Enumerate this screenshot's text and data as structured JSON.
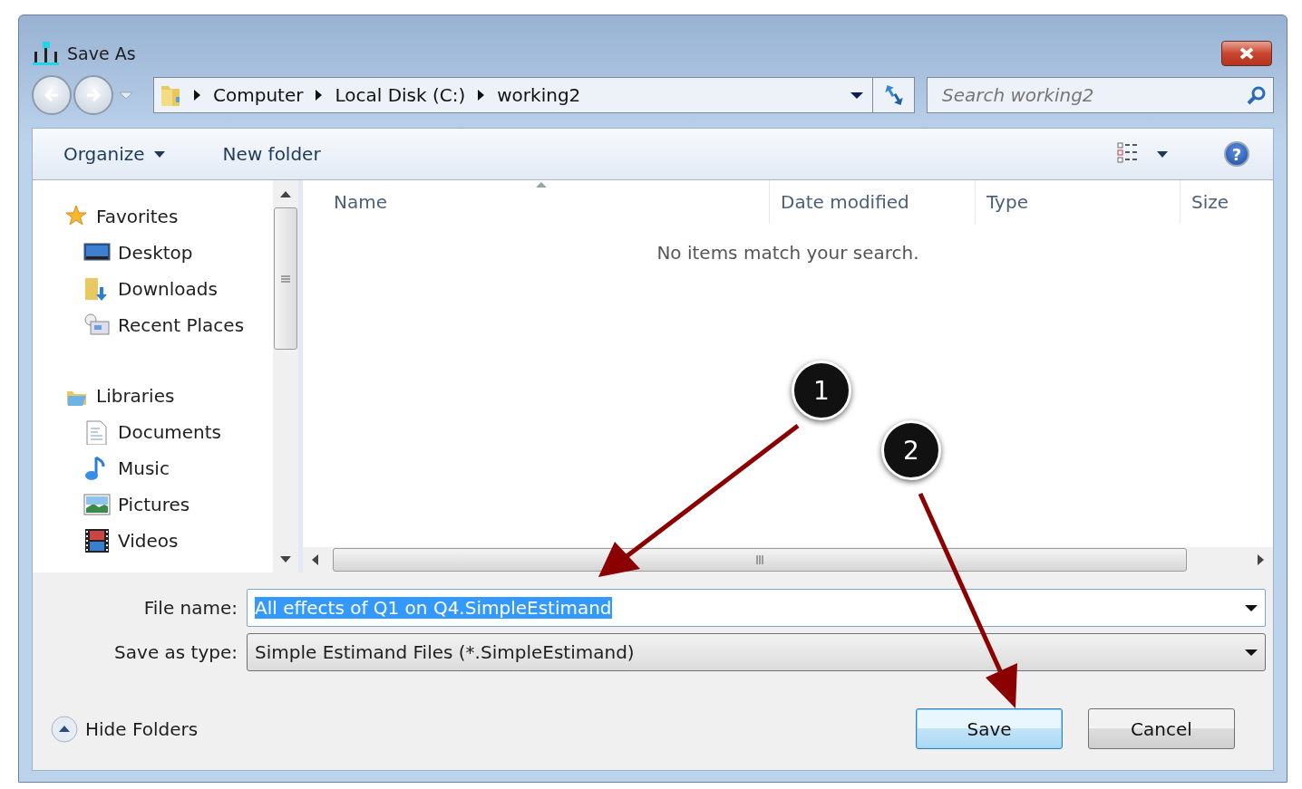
{
  "window": {
    "title": "Save As"
  },
  "address_bar": {
    "path": [
      "Computer",
      "Local Disk (C:)",
      "working2"
    ]
  },
  "search": {
    "placeholder": "Search working2"
  },
  "toolbar": {
    "items": [
      "Organize",
      "New folder"
    ],
    "help": "?"
  },
  "sidebar": {
    "groups": [
      {
        "label": "Favorites",
        "children": [
          {
            "label": "Desktop"
          },
          {
            "label": "Downloads"
          },
          {
            "label": "Recent Places"
          }
        ]
      },
      {
        "label": "Libraries",
        "children": [
          {
            "label": "Documents"
          },
          {
            "label": "Music"
          },
          {
            "label": "Pictures"
          },
          {
            "label": "Videos"
          }
        ]
      }
    ]
  },
  "file_list": {
    "columns": [
      {
        "label": "Name",
        "sorted": true
      },
      {
        "label": "Date modified",
        "sorted": false
      },
      {
        "label": "Type",
        "sorted": false
      },
      {
        "label": "Size",
        "sorted": false
      }
    ],
    "empty_message": "No items match your search."
  },
  "form": {
    "file_name": {
      "label": "File name:",
      "value": "All effects of Q1 on Q4.SimpleEstimand",
      "selected": true
    },
    "save_as_type": {
      "label": "Save as type:",
      "value": "Simple Estimand Files (*.SimpleEstimand)"
    }
  },
  "hide_folders": {
    "label": "Hide Folders"
  },
  "buttons": [
    {
      "label": "Save",
      "default": true
    },
    {
      "label": "Cancel",
      "default": false
    }
  ],
  "callouts": [
    {
      "number": "1"
    },
    {
      "number": "2"
    }
  ]
}
